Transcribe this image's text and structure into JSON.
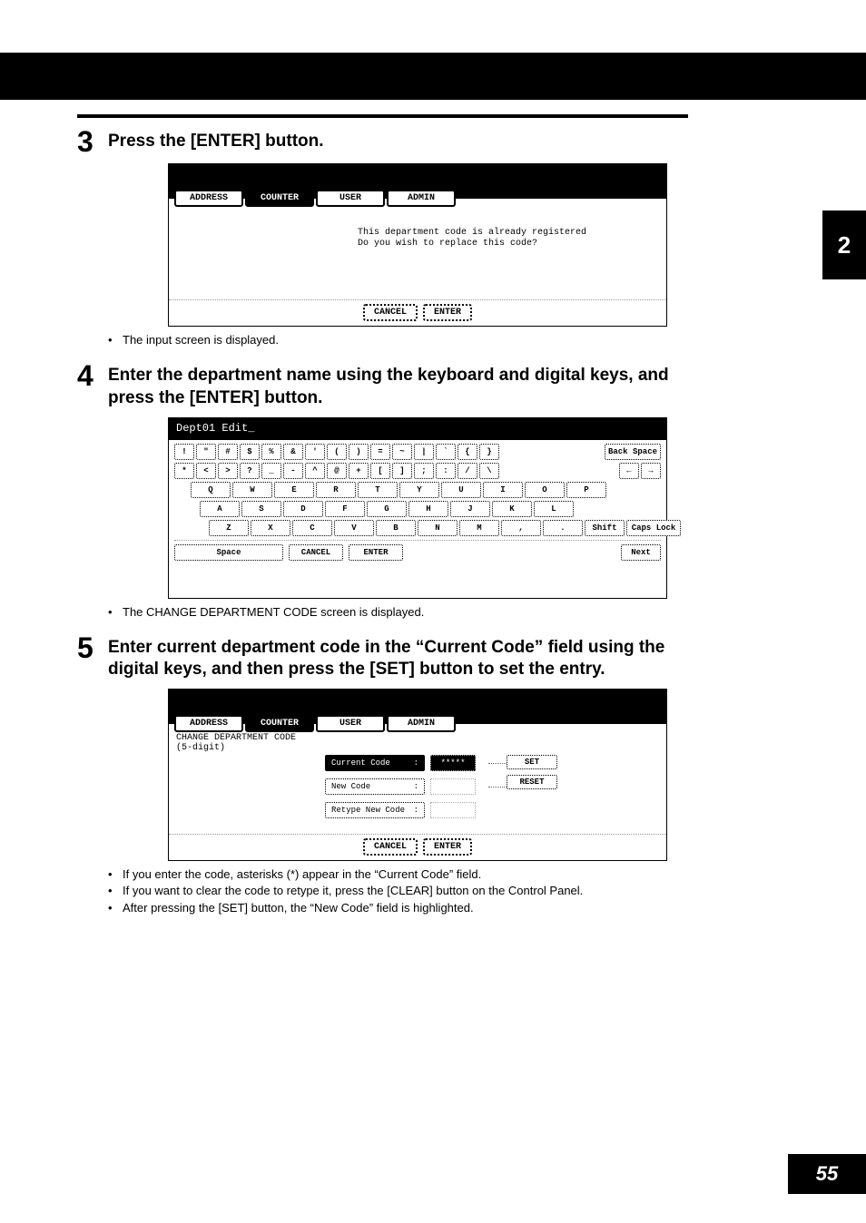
{
  "sidebar_chapter": "2",
  "page_number": "55",
  "steps": [
    {
      "number": "3",
      "text": "Press the [ENTER] button.",
      "after_bullets": [
        "The input screen is displayed."
      ]
    },
    {
      "number": "4",
      "text": "Enter the department name using the keyboard and digital keys, and press the [ENTER] button.",
      "after_bullets": [
        "The CHANGE DEPARTMENT CODE screen is displayed."
      ]
    },
    {
      "number": "5",
      "text": "Enter current department code in the “Current Code” field using the digital keys, and then press the [SET] button to set the entry.",
      "after_bullets": [
        "If you enter the code, asterisks (*) appear in the “Current Code” field.",
        "If you want to clear the code to retype it, press the [CLEAR] button on the Control Panel.",
        "After pressing the [SET] button, the “New Code” field is highlighted."
      ]
    }
  ],
  "screenshot1": {
    "tabs": [
      "ADDRESS",
      "COUNTER",
      "USER",
      "ADMIN"
    ],
    "active_tab_index": 1,
    "message_line1": "This department code is already registered",
    "message_line2": "Do you wish to replace this code?",
    "buttons": [
      "CANCEL",
      "ENTER"
    ]
  },
  "screenshot2": {
    "title": "Dept01 Edit_",
    "row1": [
      "!",
      "\"",
      "#",
      "$",
      "%",
      "&",
      "'",
      "(",
      ")",
      "=",
      "~",
      "|",
      "`",
      "{",
      "}"
    ],
    "row1_right": "Back Space",
    "row2": [
      "*",
      "<",
      ">",
      "?",
      "_",
      "-",
      "^",
      "@",
      "+",
      "[",
      "]",
      ";",
      ":",
      "/",
      "\\"
    ],
    "row2_right": [
      "←",
      "→"
    ],
    "row3": [
      "Q",
      "W",
      "E",
      "R",
      "T",
      "Y",
      "U",
      "I",
      "O",
      "P"
    ],
    "row4": [
      "A",
      "S",
      "D",
      "F",
      "G",
      "H",
      "J",
      "K",
      "L"
    ],
    "row5": [
      "Z",
      "X",
      "C",
      "V",
      "B",
      "N",
      "M",
      ",",
      "."
    ],
    "row5_right": [
      "Shift",
      "Caps Lock"
    ],
    "bottom": [
      "Space",
      "CANCEL",
      "ENTER"
    ],
    "bottom_right": "Next"
  },
  "screenshot3": {
    "tabs": [
      "ADDRESS",
      "COUNTER",
      "USER",
      "ADMIN"
    ],
    "active_tab_index": 1,
    "title": "CHANGE DEPARTMENT CODE",
    "subtitle": "(5-digit)",
    "fields": [
      {
        "label": "Current Code",
        "colon": ":",
        "value": "*****",
        "active": true
      },
      {
        "label": "New Code",
        "colon": ":",
        "value": "",
        "active": false
      },
      {
        "label": "Retype New Code",
        "colon": ":",
        "value": "",
        "active": false
      }
    ],
    "side_buttons": [
      "SET",
      "RESET"
    ],
    "buttons": [
      "CANCEL",
      "ENTER"
    ]
  }
}
